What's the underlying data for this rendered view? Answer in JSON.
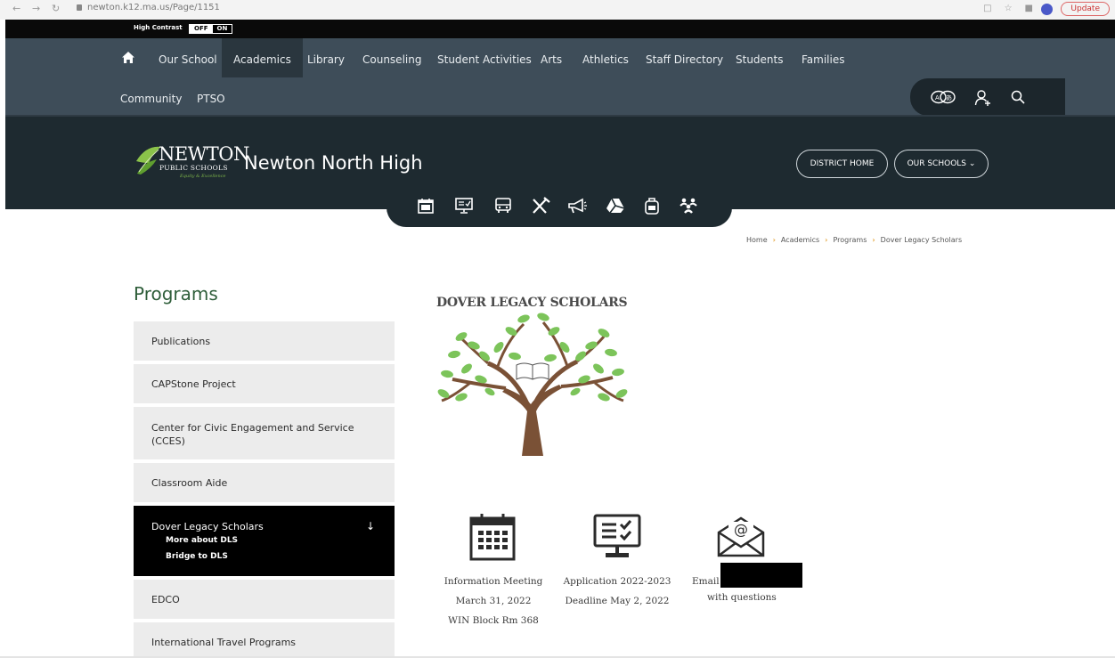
{
  "browser": {
    "url": "newton.k12.ma.us/Page/1151",
    "update_label": "Update"
  },
  "contrast": {
    "label": "High Contrast",
    "off_label": "OFF",
    "on_label": "ON"
  },
  "nav": {
    "items": [
      "Our School",
      "Academics",
      "Library",
      "Counseling",
      "Student Activities",
      "Arts",
      "Athletics",
      "Staff Directory",
      "Students",
      "Families"
    ],
    "items_row2": [
      "Community",
      "PTSO"
    ]
  },
  "header": {
    "logo_main": "NEWTON",
    "logo_sub": "PUBLIC SCHOOLS",
    "logo_tag": "Equity & Excellence",
    "school_title": "Newton North High",
    "district_home": "DISTRICT HOME",
    "our_schools": "OUR SCHOOLS"
  },
  "breadcrumb": [
    "Home",
    "Academics",
    "Programs",
    "Dover Legacy Scholars"
  ],
  "sidebar": {
    "title": "Programs",
    "items": [
      {
        "label": "Publications"
      },
      {
        "label": "CAPStone Project"
      },
      {
        "label": "Center for Civic Engagement and Service (CCES)"
      },
      {
        "label": "Classroom Aide"
      },
      {
        "label": "Dover Legacy Scholars",
        "subitems": [
          "More about DLS",
          "Bridge to DLS"
        ]
      },
      {
        "label": "EDCO"
      },
      {
        "label": "International Travel Programs"
      }
    ]
  },
  "main": {
    "heading": "DOVER LEGACY SCHOLARS",
    "info": [
      {
        "line1": "Information Meeting",
        "line2": "March 31, 2022",
        "line3": "WIN Block Rm 368"
      },
      {
        "line1": "Application 2022-2023",
        "line2": "Deadline May 2, 2022"
      },
      {
        "line1": "Email",
        "line2": "with questions"
      }
    ]
  },
  "colors": {
    "nav_bg": "#3e4d59",
    "header_bg": "#1e2a30",
    "sidebar_title": "#2f5e3a",
    "breadcrumb_sep": "#e3a53c",
    "active_item": "#000000"
  }
}
